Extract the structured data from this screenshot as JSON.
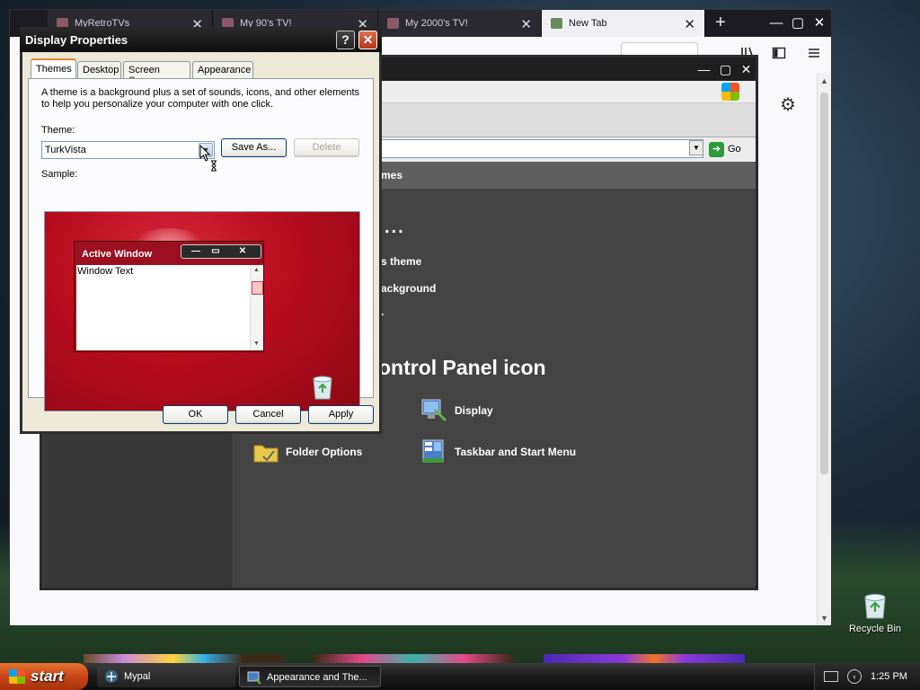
{
  "browser": {
    "tabs": [
      {
        "title": "MyRetroTVs",
        "active": false
      },
      {
        "title": "My 90's TV!",
        "active": false
      },
      {
        "title": "My 2000's TV!",
        "active": false
      },
      {
        "title": "New Tab",
        "active": true
      }
    ],
    "new_tab_glyph": "+",
    "window_controls": {
      "minimize": "—",
      "maximize": "▢",
      "close": "✕"
    },
    "toolbar_icons": [
      "library-icon",
      "sidebar-icon",
      "menu-icon"
    ],
    "settings_icon": "gear-icon"
  },
  "explorer": {
    "window_controls": {
      "minimize": "—",
      "maximize": "▢",
      "close": "✕"
    },
    "go_label": "Go",
    "header_text": "mes",
    "ellipsis": "...",
    "task_links": [
      "s theme",
      "ackground",
      "."
    ],
    "section_title": "ontrol Panel icon",
    "icons": [
      {
        "label": "Display",
        "icon": "display-icon"
      },
      {
        "label": "Folder Options",
        "icon": "folder-icon"
      },
      {
        "label": "Taskbar and Start Menu",
        "icon": "taskbar-icon"
      }
    ]
  },
  "dialog": {
    "title": "Display Properties",
    "help_glyph": "?",
    "close_glyph": "✕",
    "tabs": [
      "Themes",
      "Desktop",
      "Screen Saver",
      "Appearance"
    ],
    "active_tab": "Themes",
    "description": "A theme is a background plus a set of sounds, icons, and other elements to help you personalize your computer with one click.",
    "theme_label": "Theme:",
    "theme_value": "TurkVista",
    "save_as": "Save As...",
    "delete": "Delete",
    "sample_label": "Sample:",
    "sample": {
      "active_window_title": "Active Window",
      "window_text": "Window Text",
      "buttons": {
        "minimize": "—",
        "maximize": "▭",
        "close": "✕"
      }
    },
    "ok": "OK",
    "cancel": "Cancel",
    "apply": "Apply"
  },
  "desktop": {
    "recycle_bin_label": "Recycle Bin"
  },
  "taskbar": {
    "start_label": "start",
    "tasks": [
      {
        "label": "Mypal",
        "active": false
      },
      {
        "label": "Appearance and The...",
        "active": true
      }
    ],
    "clock": "1:25 PM",
    "tray_glyph": "‹"
  },
  "colors": {
    "xp_accent": "#e68b2c",
    "sample_red": "#b80d1f",
    "start_orange": "#c8461a",
    "go_green": "#2f9a3a"
  }
}
